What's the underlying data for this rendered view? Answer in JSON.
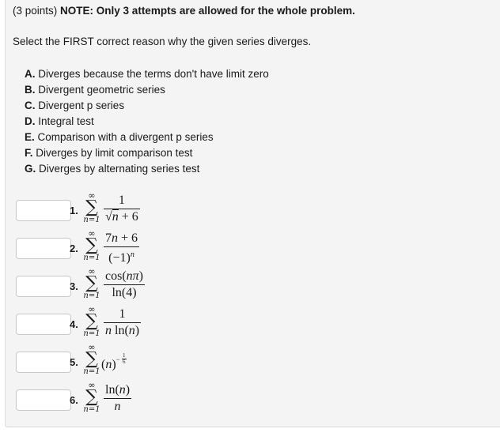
{
  "header": {
    "points": "(3 points)",
    "note": "NOTE: Only 3 attempts are allowed for the whole problem."
  },
  "instruction": "Select the FIRST correct reason why the given series diverges.",
  "options": [
    {
      "letter": "A.",
      "text": "Diverges because the terms don't have limit zero"
    },
    {
      "letter": "B.",
      "text": "Divergent geometric series"
    },
    {
      "letter": "C.",
      "text": "Divergent p series"
    },
    {
      "letter": "D.",
      "text": "Integral test"
    },
    {
      "letter": "E.",
      "text": "Comparison with a divergent p series"
    },
    {
      "letter": "F.",
      "text": "Diverges by limit comparison test"
    },
    {
      "letter": "G.",
      "text": "Diverges by alternating series test"
    }
  ],
  "sum": {
    "upper": "∞",
    "symbol": "∑",
    "lower": "n=1"
  },
  "problems": [
    {
      "number": "1.",
      "answer": "",
      "numerator": "1",
      "denominator_prefix": "√",
      "denominator_var": "n",
      "denominator_suffix": " + 6"
    },
    {
      "number": "2.",
      "answer": "",
      "numerator_coef": "7",
      "numerator_var": "n",
      "numerator_suffix": " + 6",
      "denominator_base": "(−1)",
      "denominator_exp": "n"
    },
    {
      "number": "3.",
      "answer": "",
      "numerator_pre": "cos(",
      "numerator_var": "nπ",
      "numerator_post": ")",
      "denominator": "ln(4)"
    },
    {
      "number": "4.",
      "answer": "",
      "numerator": "1",
      "denominator_var": "n",
      "denominator_mid": " ln(",
      "denominator_var2": "n",
      "denominator_post": ")"
    },
    {
      "number": "5.",
      "answer": "",
      "base_pre": "(",
      "base_var": "n",
      "base_post": ")",
      "exp_sign": "−",
      "exp_num": "1",
      "exp_den": "6"
    },
    {
      "number": "6.",
      "answer": "",
      "numerator_pre": "ln(",
      "numerator_var": "n",
      "numerator_post": ")",
      "denominator_var": "n"
    }
  ]
}
